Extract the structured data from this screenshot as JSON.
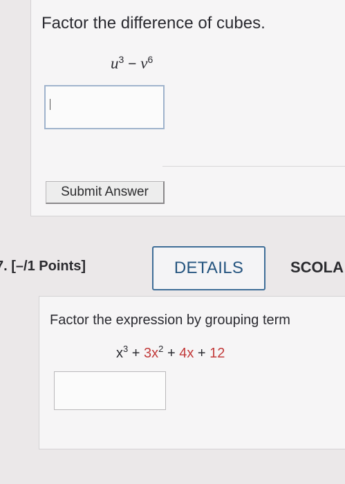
{
  "question6": {
    "prompt": "Factor the difference of cubes.",
    "expression": {
      "term1_base": "u",
      "term1_exp": "3",
      "operator": "−",
      "term2_base": "v",
      "term2_exp": "6"
    },
    "answer_value": "",
    "submit_label": "Submit Answer"
  },
  "question7": {
    "number_label": "7.",
    "points_label": "[–/1 Points]",
    "details_label": "DETAILS",
    "source_label": "SCOLA",
    "prompt": "Factor the expression by grouping term",
    "expression": {
      "t1_base": "x",
      "t1_exp": "3",
      "op1": "+",
      "t2_base": "3x",
      "t2_exp": "2",
      "op2": "+",
      "t3": "4x",
      "op3": "+",
      "t4": "12"
    },
    "answer_value": ""
  },
  "colors": {
    "background": "#ebe8e9",
    "panel": "#f6f5f6",
    "details_border": "#3e6d97",
    "details_text": "#24547f",
    "coefficient_red": "#c23a3a",
    "answer_border_focus": "#9fb3cc"
  }
}
